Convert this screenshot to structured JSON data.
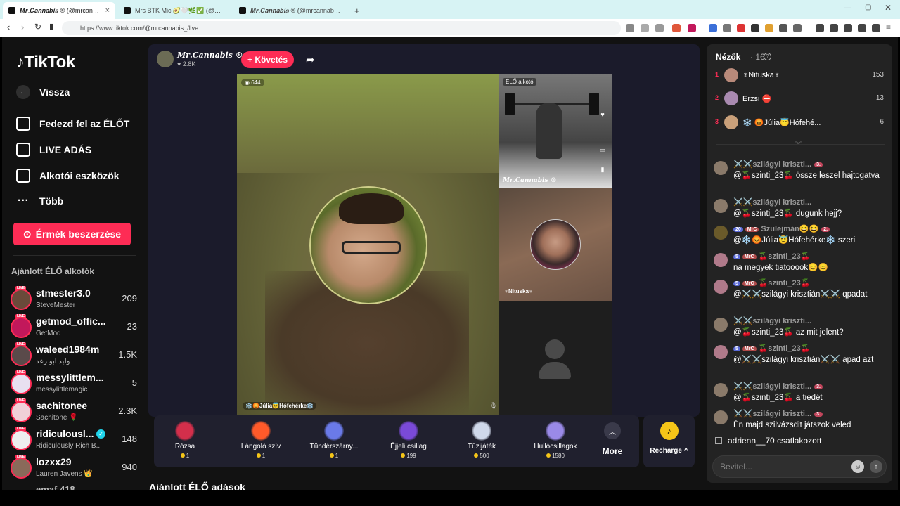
{
  "browser": {
    "tabs": [
      {
        "title": "𝑴𝒓.𝑪𝒂𝒏𝒏𝒂𝒃𝒊𝒔 ® (@mrcannabis_)",
        "close": "×"
      },
      {
        "title": "Mrs BTK Mici🥑🤍🌿✅ (@mrsbtk) E"
      },
      {
        "title": "𝑴𝒓.𝑪𝒂𝒏𝒏𝒂𝒃𝒊𝒔 ® (@mrcannabis_)"
      }
    ],
    "new_tab": "+",
    "url": "https://www.tiktok.com/@mrcannabis_/live"
  },
  "sidebar": {
    "logo": "TikTok",
    "back": "Vissza",
    "nav": [
      "Fedezd fel az ÉLŐT",
      "LIVE ADÁS",
      "Alkotói eszközök",
      "Több"
    ],
    "coins_button": "Érmék beszerzése",
    "recommended_title": "Ajánlott ÉLŐ alkotók",
    "live_badge": "LIVE",
    "creators": [
      {
        "name": "stmester3.0",
        "sub": "SteveMester",
        "count": "209"
      },
      {
        "name": "getmod_offic...",
        "sub": "GetMod",
        "count": "23"
      },
      {
        "name": "waleed1984m",
        "sub": "وليد ابو رعد",
        "count": "1.5K"
      },
      {
        "name": "messylittlem...",
        "sub": "messylittlemagic",
        "count": "5"
      },
      {
        "name": "sachitonee",
        "sub": "Sachitone 🌹",
        "count": "2.3K"
      },
      {
        "name": "ridiculousl...",
        "sub": "Ridiculously Rich B...",
        "count": "148"
      },
      {
        "name": "lozxx29",
        "sub": "Lauren Javens 👑",
        "count": "940"
      }
    ],
    "cut_item": "emaf 418"
  },
  "stream": {
    "host_name": "𝑴𝒓.𝑪𝒂𝒏𝒏𝒂𝒃𝒊𝒔 ®",
    "host_likes": "♥ 2.8K",
    "follow": "+ Követés",
    "main_count": "644",
    "main_name": "❄️😡Júlia😇Hófehérke❄️",
    "creator_tag": "ÉLŐ alkotó",
    "watermark": "𝑴𝒓.𝑪𝒂𝒏𝒏𝒂𝒃𝒊𝒔 ®",
    "tile2_count": "534",
    "tile2_name": "♆Nituska♆"
  },
  "gifts": [
    {
      "name": "Rózsa",
      "price": "1",
      "color": "#d32f4b"
    },
    {
      "name": "Lángoló szív",
      "price": "1",
      "color": "#ff5a2a"
    },
    {
      "name": "Tündérszárny...",
      "price": "1",
      "color": "#6a7ae8"
    },
    {
      "name": "Éjjeli csillag",
      "price": "199",
      "color": "#7a4ad8"
    },
    {
      "name": "Tűzijáték",
      "price": "500",
      "color": "#cfd8ea"
    },
    {
      "name": "Hullócsillagok",
      "price": "1580",
      "color": "#9a8ae8"
    }
  ],
  "more_label": "More",
  "recharge_label": "Recharge ^",
  "recommended_live_title": "Ajánlott ÉLŐ adások",
  "chat": {
    "viewers_title": "Nézők",
    "viewers_count": "· 16",
    "ranking": [
      {
        "rank": "1",
        "name": "♆Nituska♆",
        "value": "153",
        "color": "#b98a7a"
      },
      {
        "rank": "2",
        "name": "Erzsi ⛔",
        "value": "13",
        "color": "#a98ab0"
      },
      {
        "rank": "3",
        "name": "❄️ 😡Júlia😇Hófehé...",
        "value": "6",
        "color": "#c9a07a"
      }
    ],
    "messages": [
      {
        "head": "⚔️⚔️szilágyi kriszti...",
        "badges": [
          "3."
        ],
        "text": "@🍒szinti_23🍒 össze leszel hajtogatva"
      },
      {
        "head": "⚔️⚔️szilágyi kriszti...",
        "badges": [],
        "text": "@🍒szinti_23🍒 dugunk hejj?"
      },
      {
        "head": "Szulejmán😆😆",
        "badges": [
          "20",
          "MrC",
          "2."
        ],
        "text": "@❄️😡Júlia😇Hófehérke❄️ szeri"
      },
      {
        "head": "🍒szinti_23🍒",
        "badges": [
          "5",
          "MrC"
        ],
        "text": "na megyek tiatooook😊😊"
      },
      {
        "head": "🍒szinti_23🍒",
        "badges": [
          "5",
          "MrC"
        ],
        "text": "@⚔️⚔️szilágyi krisztián⚔️⚔️ qpadat"
      },
      {
        "head": "⚔️⚔️szilágyi kriszti...",
        "badges": [],
        "text": "@🍒szinti_23🍒 az mit jelent?"
      },
      {
        "head": "🍒szinti_23🍒",
        "badges": [
          "5",
          "MrC"
        ],
        "text": "@⚔️⚔️szilágyi krisztián⚔️⚔️ apad azt"
      },
      {
        "head": "⚔️⚔️szilágyi kriszti...",
        "badges": [
          "3."
        ],
        "text": "@🍒szinti_23🍒 a tiedét"
      },
      {
        "head": "⚔️⚔️szilágyi kriszti...",
        "badges": [
          "3."
        ],
        "text": "Én majd szilvázsdit játszok veled"
      }
    ],
    "joined": "adrienn__70  csatlakozott",
    "input_placeholder": "Bevitel..."
  }
}
